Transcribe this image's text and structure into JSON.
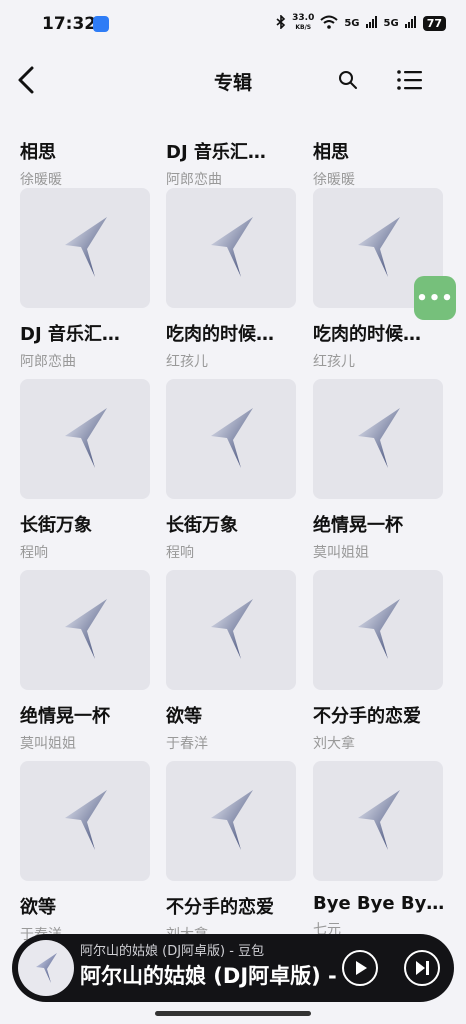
{
  "status": {
    "time": "17:32",
    "net_speed_top": "33.0",
    "net_speed_bottom": "KB/S",
    "sig1": "5G",
    "sig2": "5G",
    "battery": "77"
  },
  "header": {
    "title": "专辑",
    "back_icon": "chevron-left-icon",
    "search_icon": "search-icon",
    "menu_icon": "list-menu-icon"
  },
  "top_row": [
    {
      "title": "相思",
      "artist": "徐暖暖"
    },
    {
      "title": "DJ 音乐汇…",
      "artist": "阿郎恋曲"
    },
    {
      "title": "相思",
      "artist": "徐暖暖"
    }
  ],
  "albums": [
    {
      "title": "DJ 音乐汇…",
      "artist": "阿郎恋曲"
    },
    {
      "title": "吃肉的时候…",
      "artist": "红孩儿"
    },
    {
      "title": "吃肉的时候…",
      "artist": "红孩儿"
    },
    {
      "title": "长街万象",
      "artist": "程响"
    },
    {
      "title": "长街万象",
      "artist": "程响"
    },
    {
      "title": "绝情晃一杯",
      "artist": "莫叫姐姐"
    },
    {
      "title": "绝情晃一杯",
      "artist": "莫叫姐姐"
    },
    {
      "title": "欲等",
      "artist": "于春洋"
    },
    {
      "title": "不分手的恋爱",
      "artist": "刘大拿"
    },
    {
      "title": "欲等",
      "artist": "于春洋"
    },
    {
      "title": "不分手的恋爱",
      "artist": "刘大拿"
    },
    {
      "title": "Bye Bye By…",
      "artist": "七元"
    }
  ],
  "floating": {
    "label": "•••"
  },
  "player": {
    "subtitle": "阿尔山的姑娘 (DJ阿卓版) - 豆包",
    "title": "阿尔山的姑娘 (DJ阿卓版) - 豆包",
    "play_icon": "play-icon",
    "next_icon": "skip-next-icon"
  }
}
